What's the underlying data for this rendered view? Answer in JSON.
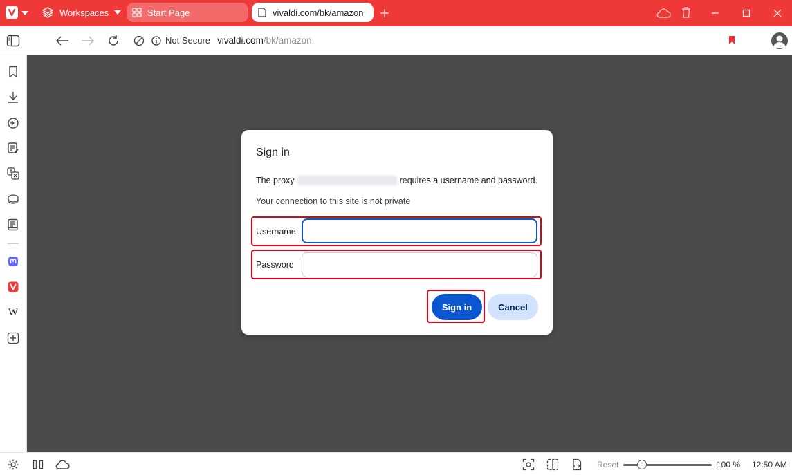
{
  "browser": {
    "accent_color": "#ef3939",
    "workspaces_label": "Workspaces",
    "tabs": [
      {
        "label": "Start Page",
        "icon": "grid-icon"
      },
      {
        "label": "vivaldi.com/bk/amazon",
        "icon": "page-icon"
      }
    ],
    "address": {
      "security_label": "Not Secure",
      "host": "vivaldi.com",
      "path": "/bk/amazon"
    }
  },
  "sidebar": {
    "icons": [
      "bookmark-icon",
      "download-icon",
      "history-icon",
      "notes-icon",
      "translate-icon",
      "reading-list-icon",
      "reader-icon",
      "mastodon-icon",
      "vivaldi-icon",
      "wikipedia-icon",
      "add-panel-icon"
    ]
  },
  "dialog": {
    "title": "Sign in",
    "message_before": "The proxy",
    "message_after": "requires a username and password.",
    "subtext": "Your connection to this site is not private",
    "username_label": "Username",
    "username_value": "",
    "password_label": "Password",
    "password_value": "",
    "signin_label": "Sign in",
    "cancel_label": "Cancel"
  },
  "statusbar": {
    "reset_label": "Reset",
    "zoom": "100 %",
    "zoom_level": 1.0,
    "time": "12:50 AM"
  }
}
